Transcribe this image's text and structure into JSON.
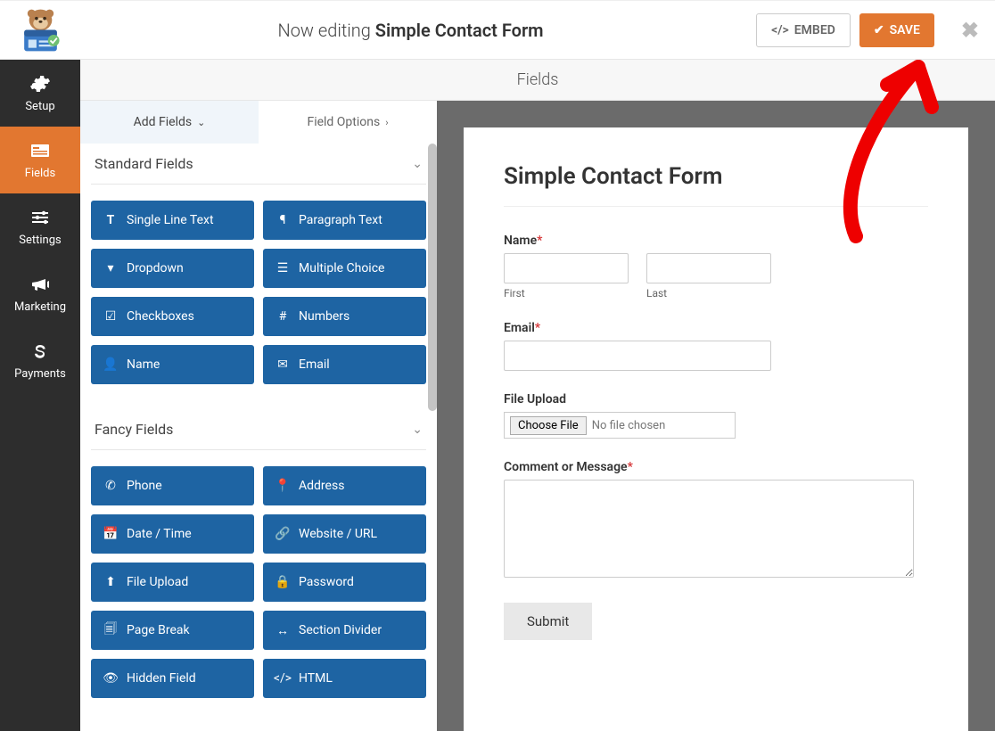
{
  "header": {
    "now_editing": "Now editing",
    "form_name": "Simple Contact Form",
    "embed_label": "EMBED",
    "save_label": "SAVE"
  },
  "sidenav": {
    "items": [
      {
        "label": "Setup",
        "icon": "gear-icon"
      },
      {
        "label": "Fields",
        "icon": "form-icon",
        "active": true
      },
      {
        "label": "Settings",
        "icon": "sliders-icon"
      },
      {
        "label": "Marketing",
        "icon": "bullhorn-icon"
      },
      {
        "label": "Payments",
        "icon": "dollar-icon"
      }
    ]
  },
  "subheader": {
    "title": "Fields"
  },
  "panel": {
    "tabs": {
      "add": "Add Fields",
      "options": "Field Options"
    },
    "sections": [
      {
        "title": "Standard Fields",
        "fields": [
          {
            "label": "Single Line Text",
            "icon": "text-icon"
          },
          {
            "label": "Paragraph Text",
            "icon": "paragraph-icon"
          },
          {
            "label": "Dropdown",
            "icon": "caret-square-icon"
          },
          {
            "label": "Multiple Choice",
            "icon": "list-icon"
          },
          {
            "label": "Checkboxes",
            "icon": "check-square-icon"
          },
          {
            "label": "Numbers",
            "icon": "hash-icon"
          },
          {
            "label": "Name",
            "icon": "user-icon"
          },
          {
            "label": "Email",
            "icon": "envelope-icon"
          }
        ]
      },
      {
        "title": "Fancy Fields",
        "fields": [
          {
            "label": "Phone",
            "icon": "phone-icon"
          },
          {
            "label": "Address",
            "icon": "marker-icon"
          },
          {
            "label": "Date / Time",
            "icon": "calendar-icon"
          },
          {
            "label": "Website / URL",
            "icon": "link-icon"
          },
          {
            "label": "File Upload",
            "icon": "upload-icon"
          },
          {
            "label": "Password",
            "icon": "lock-icon"
          },
          {
            "label": "Page Break",
            "icon": "files-icon"
          },
          {
            "label": "Section Divider",
            "icon": "arrows-h-icon"
          },
          {
            "label": "Hidden Field",
            "icon": "eye-slash-icon"
          },
          {
            "label": "HTML",
            "icon": "code-icon"
          }
        ]
      }
    ]
  },
  "preview": {
    "title": "Simple Contact Form",
    "name": {
      "label": "Name",
      "required": true,
      "first": "First",
      "last": "Last"
    },
    "email": {
      "label": "Email",
      "required": true
    },
    "file": {
      "label": "File Upload",
      "button": "Choose File",
      "status": "No file chosen"
    },
    "comment": {
      "label": "Comment or Message",
      "required": true
    },
    "submit": "Submit"
  },
  "required_mark": "*"
}
